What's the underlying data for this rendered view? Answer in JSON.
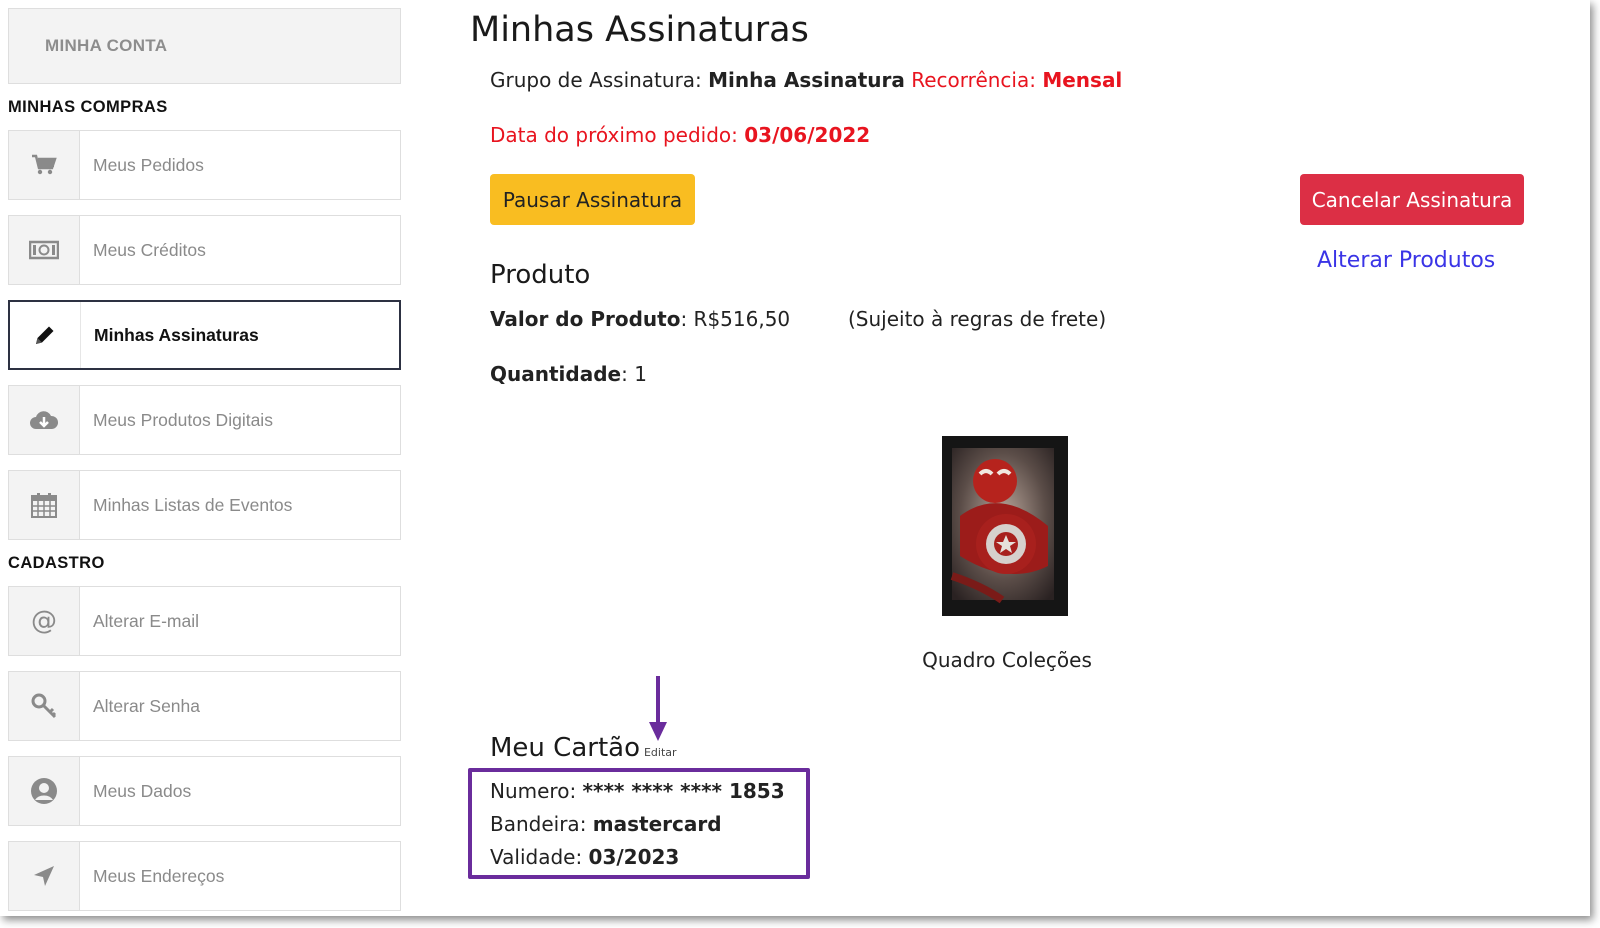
{
  "sidebar": {
    "account_label": "MINHA CONTA",
    "section_purchases": "MINHAS COMPRAS",
    "purchases": [
      {
        "label": "Meus Pedidos",
        "icon": "cart-icon"
      },
      {
        "label": "Meus Créditos",
        "icon": "money-icon"
      },
      {
        "label": "Minhas Assinaturas",
        "icon": "pencil-icon",
        "active": true
      },
      {
        "label": "Meus Produtos Digitais",
        "icon": "cloud-download-icon"
      },
      {
        "label": "Minhas Listas de Eventos",
        "icon": "calendar-icon"
      }
    ],
    "section_register": "CADASTRO",
    "register": [
      {
        "label": "Alterar E-mail",
        "icon": "at-icon"
      },
      {
        "label": "Alterar Senha",
        "icon": "key-icon"
      },
      {
        "label": "Meus Dados",
        "icon": "user-icon"
      },
      {
        "label": "Meus Endereços",
        "icon": "location-arrow-icon"
      }
    ]
  },
  "main": {
    "title": "Minhas Assinaturas",
    "group_label": "Grupo de Assinatura:",
    "group_value": "Minha Assinatura",
    "recurrence_label": "Recorrência:",
    "recurrence_value": "Mensal",
    "next_order_label": "Data do próximo pedido:",
    "next_order_value": "03/06/2022",
    "pause_button": "Pausar Assinatura",
    "cancel_button": "Cancelar Assinatura",
    "alter_products_link": "Alterar Produtos",
    "product_heading": "Produto",
    "product_value_label": "Valor do Produto",
    "product_value": ": R$516,50",
    "shipping_note": "(Sujeito à regras de frete)",
    "quantity_label": "Quantidade",
    "quantity_value": ": 1",
    "product_name": "Quadro Coleções",
    "card_heading": "Meu Cartão",
    "card_edit": "Editar",
    "card_number_label": "Numero:",
    "card_number_value": "**** **** **** 1853",
    "card_brand_label": "Bandeira:",
    "card_brand_value": "mastercard",
    "card_expiry_label": "Validade:",
    "card_expiry_value": "03/2023"
  },
  "colors": {
    "pause": "#f9bd21",
    "cancel": "#dc2f45",
    "link": "#3a34e6",
    "highlight": "#6a2c9c",
    "red_text": "#e8141f"
  }
}
